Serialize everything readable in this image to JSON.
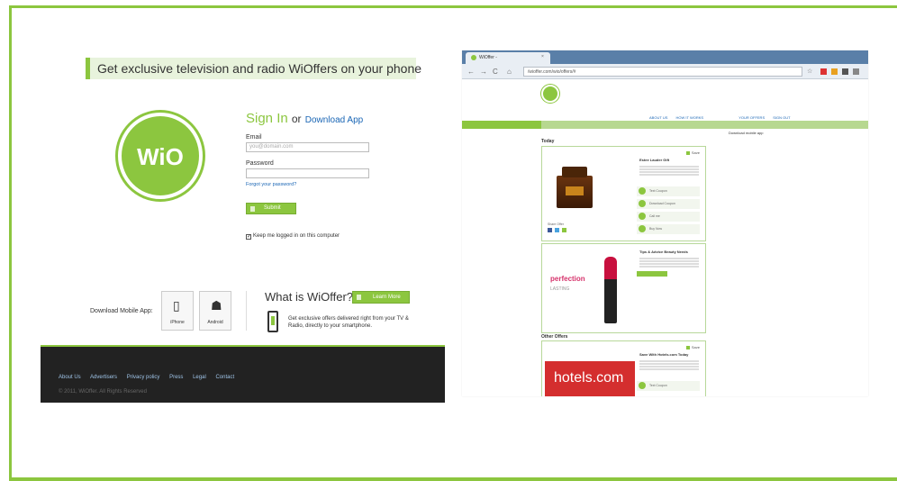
{
  "left_panel": {
    "tagline": "Get exclusive television and radio WiOffers on your phone",
    "logo_text": "WiO",
    "signin": {
      "title": "Sign In",
      "or": "or",
      "download_link": "Download App",
      "email_label": "Email",
      "email_placeholder": "you@domain.com",
      "password_label": "Password",
      "forgot_link": "Forgot your password?",
      "submit_label": "Submit",
      "keep_logged_in": "Keep me logged in on this computer"
    },
    "download": {
      "label": "Download Mobile App:",
      "iphone": "iPhone",
      "android": "Android"
    },
    "what_is": {
      "title": "What is WiOffer?",
      "learn_more": "Learn More",
      "description": "Get exclusive offers delivered right from your TV & Radio, directly to your smartphone."
    },
    "footer": {
      "links": [
        "About Us",
        "Advertisers",
        "Privacy policy",
        "Press",
        "Legal",
        "Contact"
      ],
      "copyright": "© 2011, WiOffer. All Rights Reserved"
    }
  },
  "right_panel": {
    "tab_title": "WiOffer -",
    "address": "/wioffer.com/wio/offers/#",
    "site_nav": [
      "ABOUT US",
      "HOW IT WORKS",
      "YOUR OFFERS",
      "SIGN OUT"
    ],
    "download_mobile": "Download mobile app",
    "section_today": "Today",
    "section_other": "Other Offers",
    "offers": [
      {
        "save": "Save",
        "title": "Estee Lauder Gift",
        "actions": [
          "Text Coupon",
          "Download Coupon",
          "Call me",
          "Buy Now"
        ]
      },
      {
        "save": "Save",
        "title": "Tips & Advice Beauty Needs",
        "banner": "perfection",
        "banner_sub": "LASTING"
      },
      {
        "save": "Save",
        "title": "Save With Hotels.com Today",
        "banner": "hotels.com",
        "action": "Text Coupon"
      }
    ],
    "share_label": "Share Offer"
  },
  "colors": {
    "brand_green": "#8cc63f",
    "footer_bg": "#222222",
    "link_blue": "#1a66b5"
  }
}
